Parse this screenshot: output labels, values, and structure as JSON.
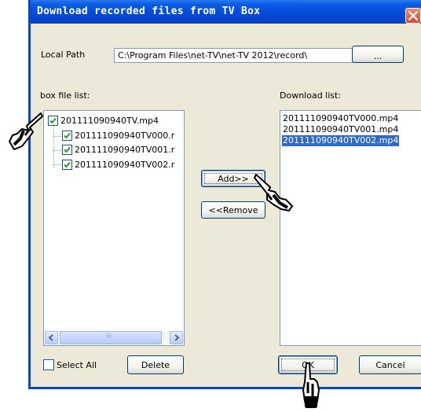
{
  "window": {
    "title": "Download recorded files from TV Box"
  },
  "local_path": {
    "label": "Local Path",
    "value": "C:\\Program Files\\net-TV\\net-TV 2012\\record\\",
    "browse_label": "..."
  },
  "box_list": {
    "label": "box file list:",
    "root": {
      "name": "201111090940TV.mp4",
      "checked": true
    },
    "children": [
      {
        "name": "201111090940TV000.r",
        "checked": true
      },
      {
        "name": "201111090940TV001.r",
        "checked": true
      },
      {
        "name": "201111090940TV002.r",
        "checked": true
      }
    ],
    "scroll_grip": "III"
  },
  "download_list": {
    "label": "Download list:",
    "items": [
      {
        "name": "201111090940TV000.mp4",
        "selected": false
      },
      {
        "name": "201111090940TV001.mp4",
        "selected": false
      },
      {
        "name": "201111090940TV002.mp4",
        "selected": true
      }
    ]
  },
  "buttons": {
    "add": "Add>>",
    "remove": "<<Remove",
    "delete": "Delete",
    "ok": "OK",
    "cancel": "Cancel"
  },
  "select_all": {
    "label": "Select All",
    "checked": false
  },
  "colors": {
    "title_bar": "#0549d6",
    "selection": "#316ac5",
    "check": "#21a121",
    "close": "#dd4a2a"
  }
}
